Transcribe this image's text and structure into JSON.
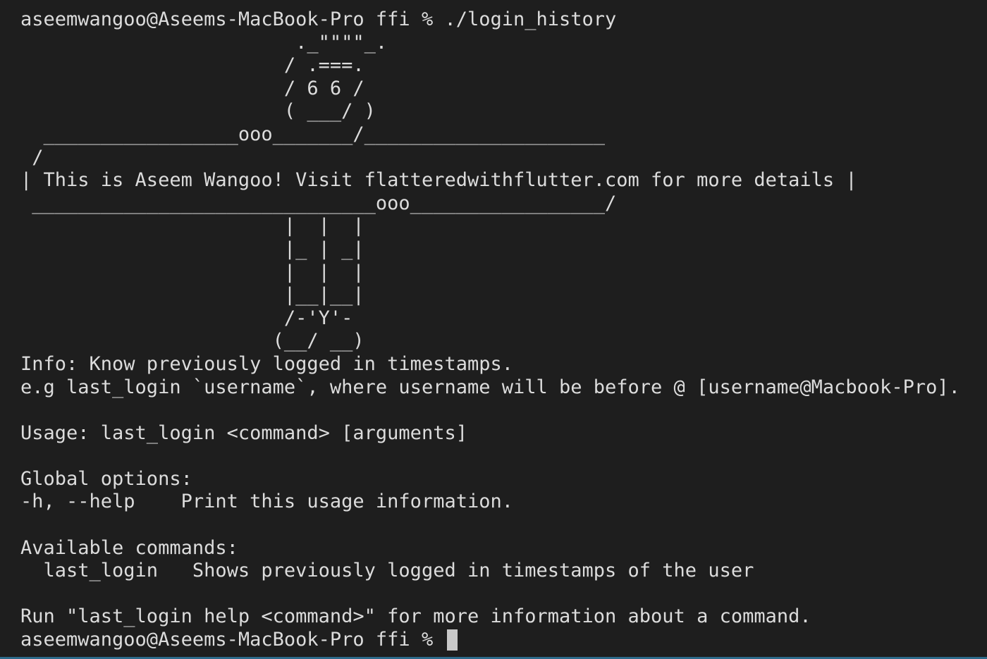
{
  "terminal": {
    "command_line": "aseemwangoo@Aseems-MacBook-Pro ffi % ./login_history",
    "art": [
      "                        ._\"\"\"\"_.",
      "                       / .===.",
      "                       / 6 6 /",
      "                       ( ___/ )",
      "  _________________ooo_______/_____________________",
      " /",
      "| This is Aseem Wangoo! Visit flatteredwithflutter.com for more details |",
      " ______________________________ooo_________________/",
      "                       |  |  |",
      "                       |_ | _|",
      "                       |  |  |",
      "                       |__|__|",
      "                       /-'Y'-",
      "                      (__/ __)"
    ],
    "info_line": "Info: Know previously logged in timestamps.",
    "example_line": "e.g last_login `username`, where username will be before @ [username@Macbook-Pro].",
    "usage_line": "Usage: last_login <command> [arguments]",
    "global_options_heading": "Global options:",
    "help_option_line": "-h, --help    Print this usage information.",
    "available_commands_heading": "Available commands:",
    "last_login_command_line": "  last_login   Shows previously logged in timestamps of the user",
    "run_help_line": "Run \"last_login help <command>\" for more information about a command.",
    "final_prompt": "aseemwangoo@Aseems-MacBook-Pro ffi % "
  },
  "colors": {
    "background": "#1e1e1e",
    "text": "#dcdcdc",
    "cursor": "#c8c8c8",
    "bottom_rule": "#2d6a8a"
  }
}
